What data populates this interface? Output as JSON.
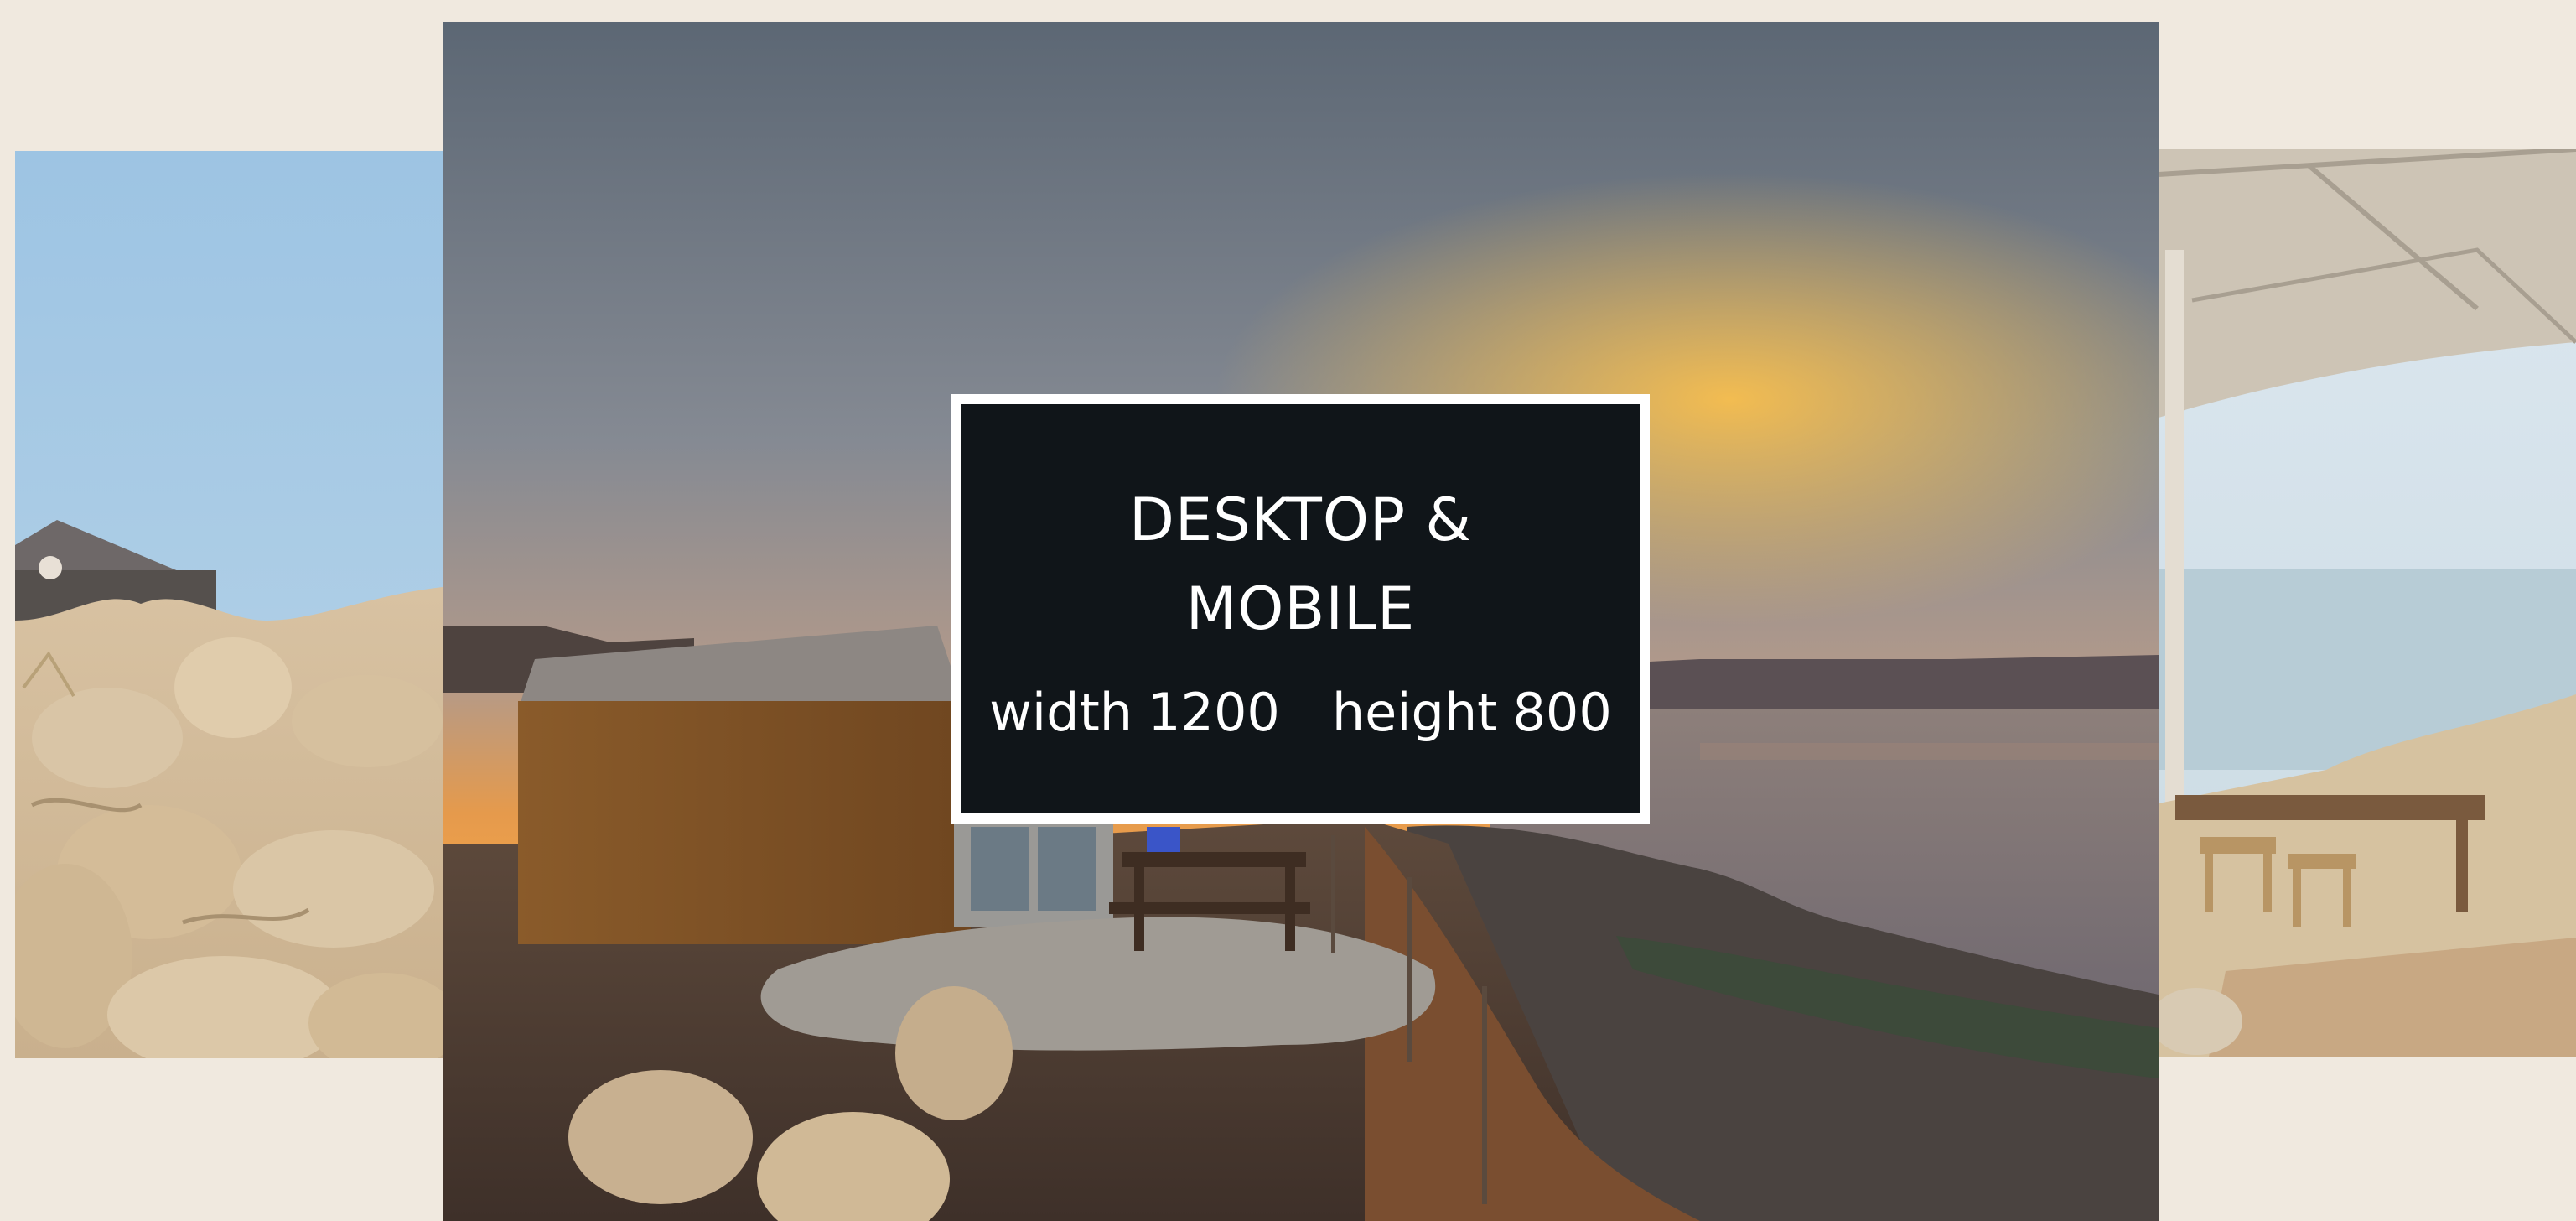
{
  "overlay": {
    "title": "DESKTOP & MOBILE",
    "width_label": "width",
    "width_value": "1200",
    "height_label": "height",
    "height_value": "800"
  },
  "slides": [
    {
      "id": "left",
      "icon": "rocky-hillside-photo"
    },
    {
      "id": "center",
      "icon": "sunset-over-sea-photo"
    },
    {
      "id": "right",
      "icon": "canopy-terrace-photo"
    }
  ],
  "colors": {
    "page_background": "#f0e9df",
    "box_background": "#101519",
    "box_border": "#ffffff",
    "box_text": "#ffffff"
  }
}
